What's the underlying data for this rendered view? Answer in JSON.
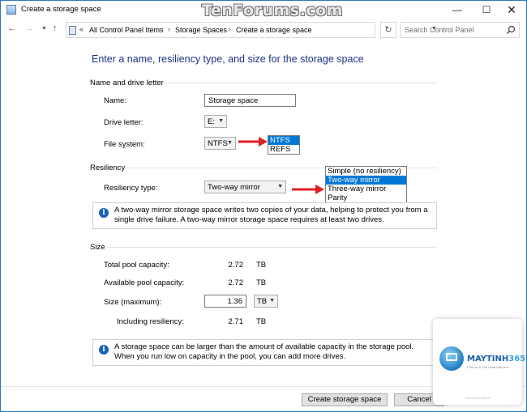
{
  "window": {
    "title": "Create a storage space",
    "watermark": "TenForums.com",
    "minimize": "—",
    "maximize": "☐",
    "close": "✕"
  },
  "address_bar": {
    "root_marker": "«",
    "crumbs": [
      "All Control Panel Items",
      "Storage Spaces",
      "Create a storage space"
    ],
    "separator": "›",
    "search_placeholder": "Search Control Panel"
  },
  "heading": "Enter a name, resiliency type, and size for the storage space",
  "name_section": {
    "title": "Name and drive letter",
    "name_label": "Name:",
    "name_value": "Storage space",
    "drive_label": "Drive letter:",
    "drive_value": "E:",
    "fs_label": "File system:",
    "fs_value": "NTFS",
    "fs_options": [
      "NTFS",
      "REFS"
    ],
    "fs_selected_index": 0
  },
  "resiliency_section": {
    "title": "Resiliency",
    "type_label": "Resiliency type:",
    "type_value": "Two-way mirror",
    "options": [
      "Simple (no resiliency)",
      "Two-way mirror",
      "Three-way mirror",
      "Parity"
    ],
    "selected_index": 1,
    "info": "A two-way mirror storage space writes two copies of your data, helping to protect you from a single drive failure. A two-way mirror storage space requires at least two drives."
  },
  "size_section": {
    "title": "Size",
    "total_label": "Total pool capacity:",
    "total_value": "2.72",
    "total_unit": "TB",
    "available_label": "Available pool capacity:",
    "available_value": "2.72",
    "available_unit": "TB",
    "size_label": "Size (maximum):",
    "size_value": "1.36",
    "size_unit": "TB",
    "including_label": "Including resiliency:",
    "including_value": "2.71",
    "including_unit": "TB",
    "info": "A storage space can be larger than the amount of available capacity in the storage pool. When you run low on capacity in the pool, you can add more drives."
  },
  "buttons": {
    "create": "Create storage space",
    "cancel": "Cancel"
  },
  "logo": {
    "name_main": "MAYTINH",
    "name_num": "365",
    "tagline": "Chia sẻ & Thủ thuật Máy tính",
    "url": "www.maytinh365.vn"
  },
  "colors": {
    "heading": "#1e3287",
    "selection": "#0078d7",
    "arrow": "#e02020",
    "info_icon": "#1a62b8"
  }
}
